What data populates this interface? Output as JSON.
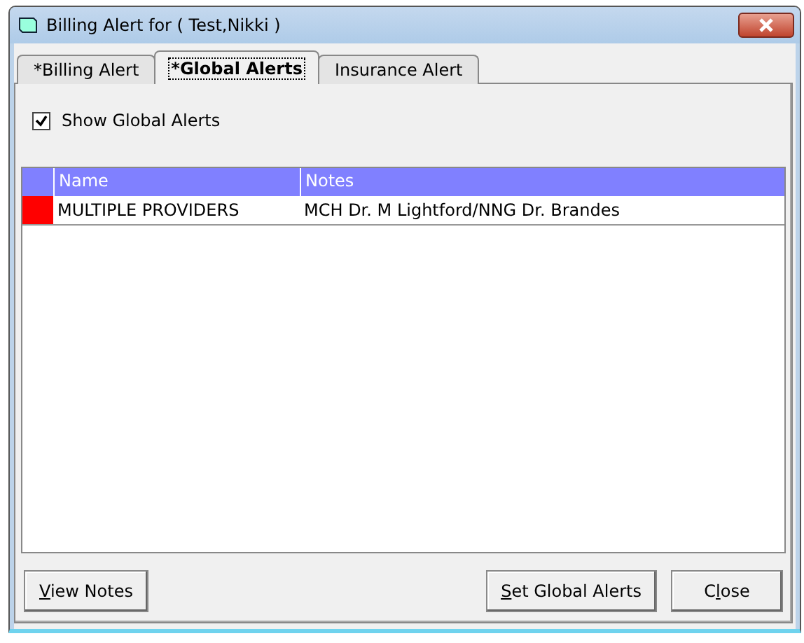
{
  "window": {
    "title": "Billing Alert for ( Test,Nikki  )"
  },
  "tabs": [
    {
      "label": "*Billing Alert",
      "selected": false
    },
    {
      "label": "*Global Alerts",
      "selected": true
    },
    {
      "label": "Insurance Alert",
      "selected": false
    }
  ],
  "show_global_alerts": {
    "label": "Show Global Alerts",
    "checked": true
  },
  "table": {
    "columns": [
      "Name",
      "Notes"
    ],
    "rows": [
      {
        "color": "#ff0000",
        "cells": [
          "MULTIPLE PROVIDERS",
          "MCH Dr. M Lightford/NNG Dr. Brandes"
        ]
      }
    ]
  },
  "buttons": [
    {
      "key": "V",
      "after": "iew Notes"
    },
    {
      "key": "S",
      "after": "et Global Alerts"
    },
    {
      "before": "C",
      "key": "l",
      "after": "ose"
    }
  ]
}
